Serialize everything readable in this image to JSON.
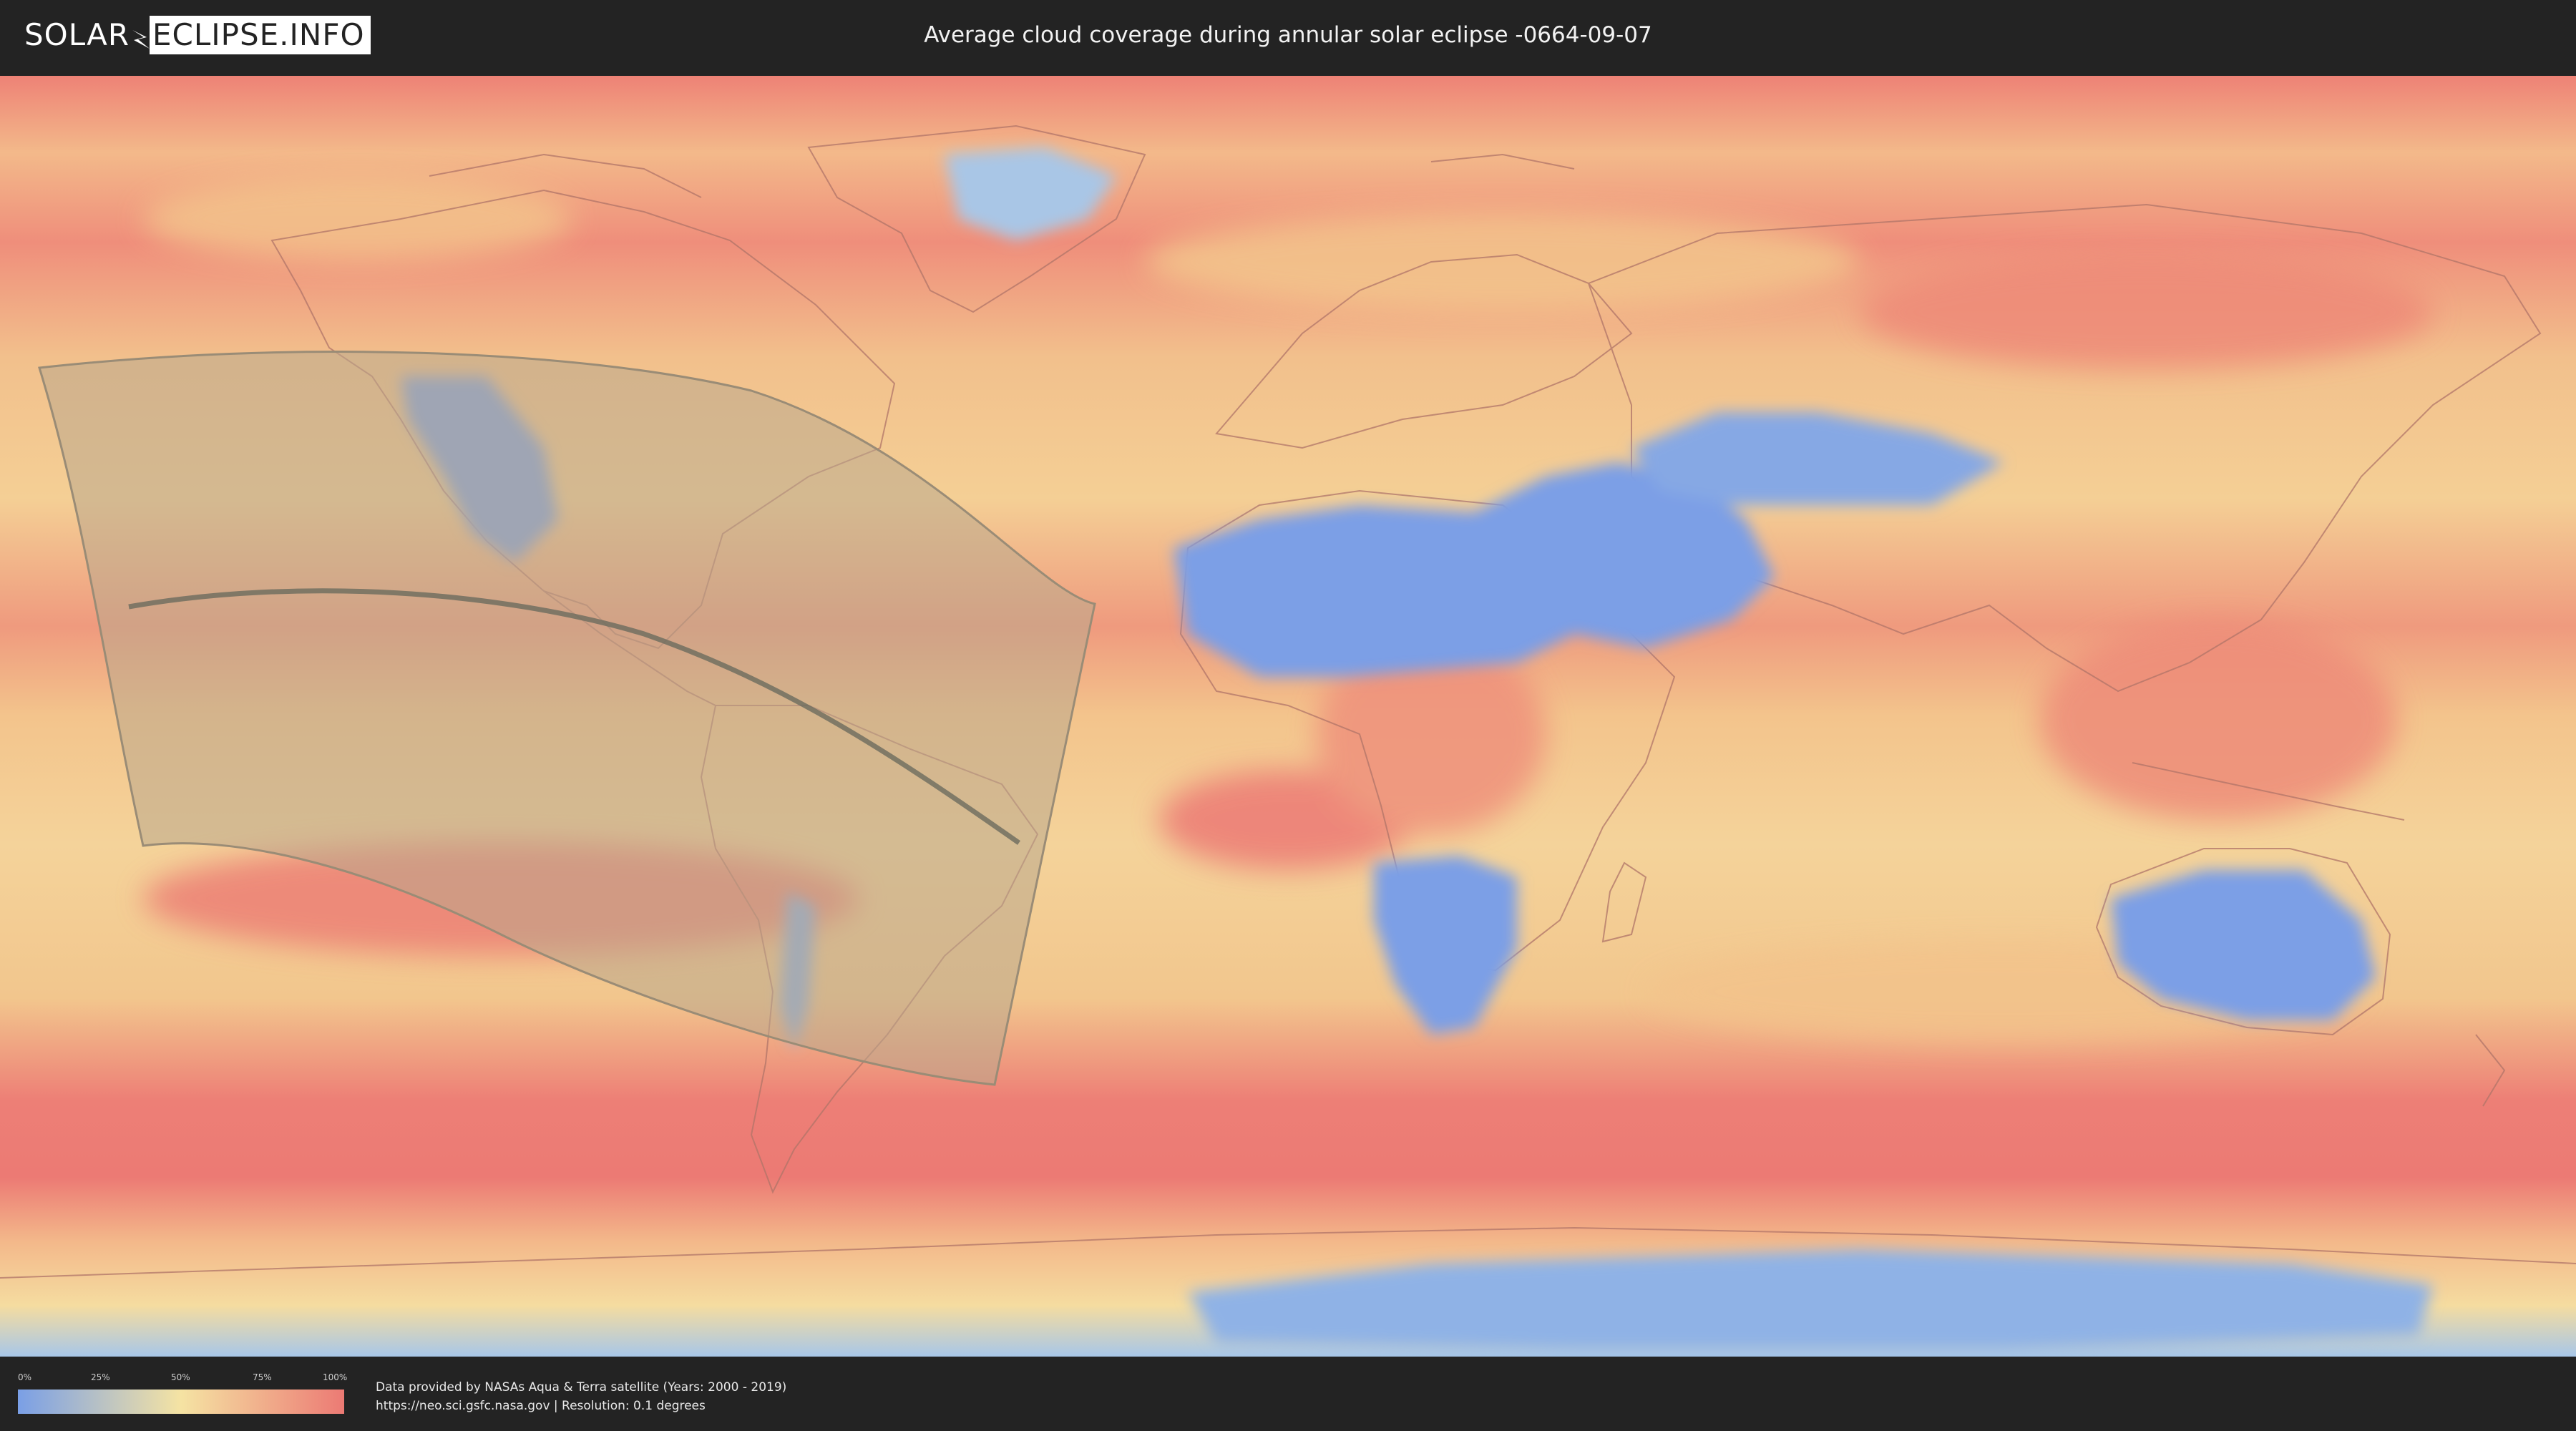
{
  "header": {
    "logo_left": "SOLAR",
    "logo_right": "ECLIPSE.INFO",
    "title": "Average cloud coverage during annular solar eclipse -0664-09-07"
  },
  "legend": {
    "ticks": [
      "0%",
      "25%",
      "50%",
      "75%",
      "100%"
    ],
    "colors": [
      "#7a9fe6",
      "#f5e3a3",
      "#ec7a74"
    ]
  },
  "credits": {
    "line1": "Data provided by NASAs Aqua & Terra satellite (Years: 2000 - 2019)",
    "line2": "https://neo.sci.gsfc.nasa.gov | Resolution: 0.1 degrees"
  },
  "map": {
    "colors": {
      "cloudy": "#ec7a74",
      "medium": "#f3c585",
      "partly": "#f5e3a3",
      "clear": "#7a9fe6",
      "eclipse_band": "#b9a88c",
      "central_line": "#6b6b5e"
    }
  }
}
